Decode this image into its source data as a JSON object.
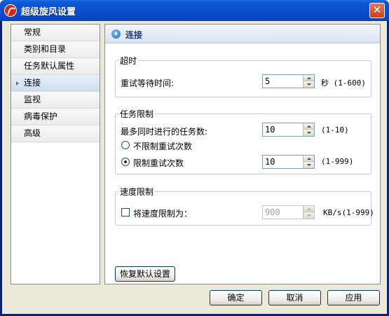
{
  "window": {
    "title": "超级旋风设置"
  },
  "sidebar": {
    "items": [
      {
        "label": "常规"
      },
      {
        "label": "类别和目录"
      },
      {
        "label": "任务默认属性"
      },
      {
        "label": "连接"
      },
      {
        "label": "监视"
      },
      {
        "label": "病毒保护"
      },
      {
        "label": "高级"
      }
    ],
    "selected": "连接"
  },
  "panel": {
    "title": "连接",
    "timeout": {
      "legend": "超时",
      "retry_wait_label": "重试等待时间:",
      "retry_wait_value": "5",
      "retry_wait_unit": "秒 (1-600)"
    },
    "task_limit": {
      "legend": "任务限制",
      "max_tasks_label": "最多同时进行的任务数:",
      "max_tasks_value": "10",
      "max_tasks_range": "(1-10)",
      "unlimited_retry_label": "不限制重试次数",
      "limit_retry_label": "限制重试次数",
      "limit_retry_value": "10",
      "limit_retry_range": "(1-999)",
      "selected_option": "限制重试次数"
    },
    "speed_limit": {
      "legend": "速度限制",
      "limit_speed_label": "将速度限制为：",
      "limit_speed_checked": false,
      "limit_speed_value": "900",
      "limit_speed_unit": "KB/s(1-999)"
    },
    "restore_defaults_label": "恢复默认设置"
  },
  "footer": {
    "ok_label": "确定",
    "cancel_label": "取消",
    "apply_label": "应用"
  }
}
